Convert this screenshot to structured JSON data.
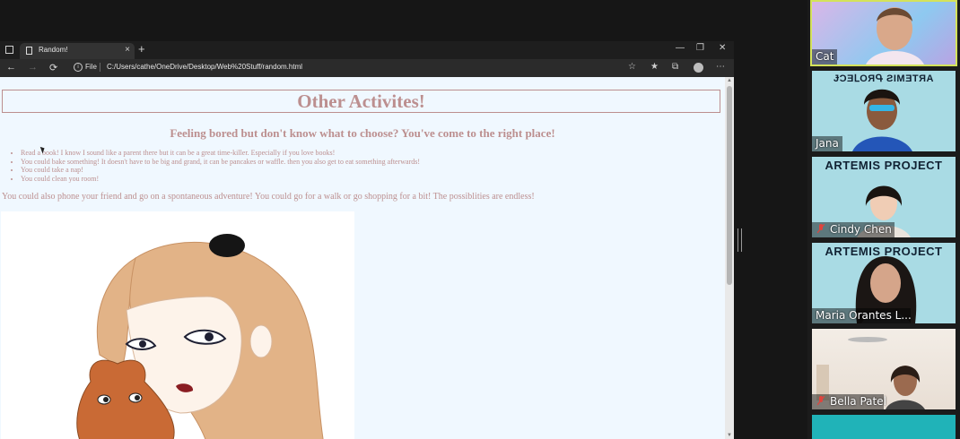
{
  "browser": {
    "tab_title": "Random!",
    "tab_close": "×",
    "new_tab": "+",
    "minimize": "—",
    "restore": "❐",
    "close": "✕",
    "back": "←",
    "forward": "→",
    "reload": "⟳",
    "file_label": "File",
    "url": "C:/Users/cathe/OneDrive/Desktop/Web%20Stuff/random.html",
    "menu": "⋯"
  },
  "page": {
    "heading": "Other Activites!",
    "subheading": "Feeling bored but don't know what to choose? You've come to the right place!",
    "list": [
      "Read a book! I know I sound like a parent there but it can be a great time-killer. Especially if you love books!",
      "You could bake something! It doesn't have to be big and grand, it can be pancakes or waffle. then you also get to eat something afterwards!",
      "You could take a nap!",
      "You could clean you room!"
    ],
    "paragraph": "You could also phone your friend and go on a spontaneous adventure! You could go for a walk or go shopping for a bit! The possiblities are endless!"
  },
  "participants": [
    {
      "name": "Cat",
      "banner": ""
    },
    {
      "name": "Jana",
      "banner": "ɈƆƎԼOЯԳ ƧIMƎTЯA"
    },
    {
      "name": "Cindy Chen",
      "banner": "ARTEMIS PROJECT"
    },
    {
      "name": "Maria Orantes L...",
      "banner": "ARTEMIS PROJECT"
    },
    {
      "name": "Bella Patel",
      "banner": ""
    }
  ],
  "colors": {
    "page_background": "#f0f8ff",
    "text_color": "#bc8f8f",
    "active_speaker_border": "#d4e25a"
  }
}
